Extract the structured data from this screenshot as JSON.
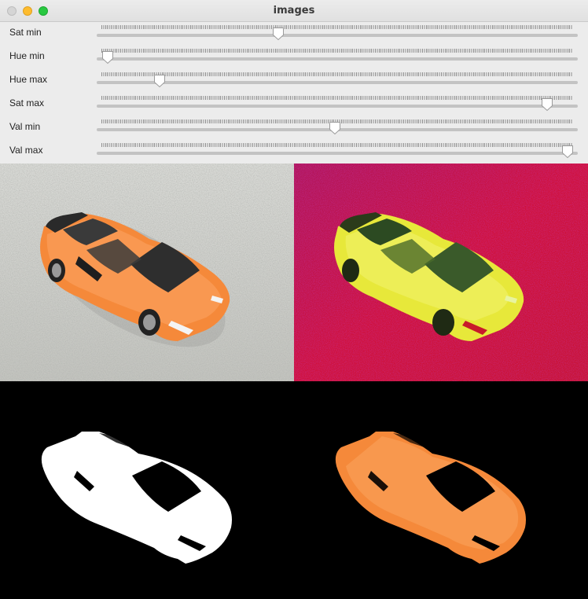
{
  "window": {
    "title": "images"
  },
  "sliders": [
    {
      "label": "Sat min",
      "value_fraction": 0.375
    },
    {
      "label": "Hue min",
      "value_fraction": 0.012
    },
    {
      "label": "Hue max",
      "value_fraction": 0.122
    },
    {
      "label": "Sat max",
      "value_fraction": 0.947
    },
    {
      "label": "Val min",
      "value_fraction": 0.495
    },
    {
      "label": "Val max",
      "value_fraction": 0.99
    }
  ],
  "panels": [
    {
      "name": "original",
      "description_icon": "car-photo"
    },
    {
      "name": "hsv",
      "description_icon": "car-hsv"
    },
    {
      "name": "mask",
      "description_icon": "car-mask"
    },
    {
      "name": "result",
      "description_icon": "car-result"
    }
  ],
  "colors": {
    "car_orange": "#f5893a",
    "hsv_background": "#c8103a",
    "hsv_car": "#e7e83a",
    "mask_white": "#ffffff",
    "close_gray": "#d5d5d5",
    "minimize_yellow": "#febc2e",
    "zoom_green": "#28c840"
  }
}
